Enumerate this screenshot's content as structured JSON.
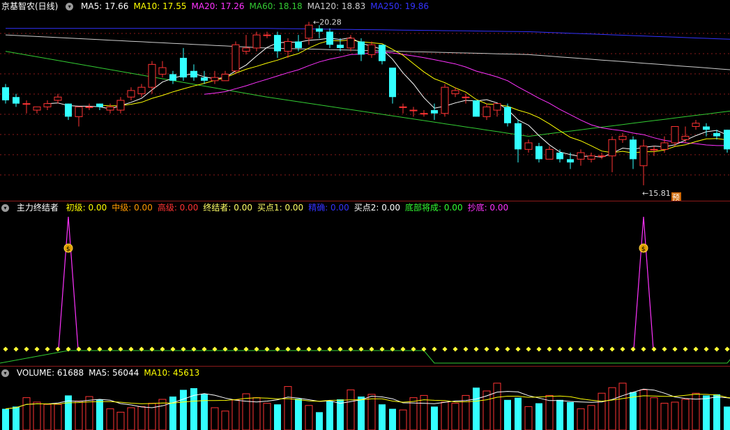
{
  "price_panel": {
    "stock_name": "京基智农(日线)",
    "indicators": [
      {
        "text": "MA5: 17.66",
        "color": "#ffffff"
      },
      {
        "text": "MA10: 17.55",
        "color": "#ffff00"
      },
      {
        "text": "MA20: 17.26",
        "color": "#ff33ff"
      },
      {
        "text": "MA60: 18.18",
        "color": "#33cc33"
      },
      {
        "text": "MA120: 18.83",
        "color": "#cccccc"
      },
      {
        "text": "MA250: 19.86",
        "color": "#3333ff"
      }
    ],
    "high_label": "20.28",
    "low_label": "15.81",
    "pre_badge": "预"
  },
  "signal_panel": {
    "title": "主力终结者",
    "indicators": [
      {
        "text": "初级: 0.00",
        "color": "#ffff00"
      },
      {
        "text": "中级: 0.00",
        "color": "#ff9900"
      },
      {
        "text": "高级: 0.00",
        "color": "#ff3333"
      },
      {
        "text": "终结者: 0.00",
        "color": "#ffff66"
      },
      {
        "text": "买点1: 0.00",
        "color": "#ffff66"
      },
      {
        "text": "精确: 0.00",
        "color": "#3333ff"
      },
      {
        "text": "买点2: 0.00",
        "color": "#ffffff"
      },
      {
        "text": "底部将成: 0.00",
        "color": "#33ff33"
      },
      {
        "text": "抄底: 0.00",
        "color": "#ff33ff"
      }
    ],
    "marker_icon": "money-bag-icon"
  },
  "volume_panel": {
    "indicators": [
      {
        "text": "VOLUME: 61688",
        "color": "#ffffff"
      },
      {
        "text": "MA5: 56044",
        "color": "#ffffff"
      },
      {
        "text": "MA10: 45613",
        "color": "#ffff00"
      }
    ]
  },
  "colors": {
    "up": "#ff3333",
    "down": "#33ffff",
    "grid": "#8b1a1a"
  },
  "chart_data": {
    "type": "candlestick",
    "ylim": [
      15.5,
      21.0
    ],
    "candles": [
      {
        "o": 18.8,
        "c": 18.4,
        "h": 18.9,
        "l": 18.3
      },
      {
        "o": 18.5,
        "c": 18.3,
        "h": 18.6,
        "l": 18.2
      },
      {
        "o": 18.3,
        "c": 18.3,
        "h": 18.4,
        "l": 18.0
      },
      {
        "o": 18.1,
        "c": 18.2,
        "h": 18.2,
        "l": 18.0
      },
      {
        "o": 18.2,
        "c": 18.3,
        "h": 18.4,
        "l": 18.1
      },
      {
        "o": 18.4,
        "c": 18.5,
        "h": 18.6,
        "l": 18.3
      },
      {
        "o": 18.3,
        "c": 17.9,
        "h": 18.3,
        "l": 17.8
      },
      {
        "o": 17.9,
        "c": 18.2,
        "h": 18.2,
        "l": 17.6
      },
      {
        "o": 18.2,
        "c": 18.2,
        "h": 18.3,
        "l": 18.1
      },
      {
        "o": 18.3,
        "c": 18.2,
        "h": 18.3,
        "l": 18.1
      },
      {
        "o": 18.1,
        "c": 18.2,
        "h": 18.3,
        "l": 18.0
      },
      {
        "o": 18.1,
        "c": 18.4,
        "h": 18.5,
        "l": 18.0
      },
      {
        "o": 18.5,
        "c": 18.7,
        "h": 18.8,
        "l": 18.4
      },
      {
        "o": 18.6,
        "c": 18.8,
        "h": 18.9,
        "l": 18.5
      },
      {
        "o": 18.8,
        "c": 19.5,
        "h": 19.6,
        "l": 18.6
      },
      {
        "o": 19.2,
        "c": 19.4,
        "h": 19.6,
        "l": 19.1
      },
      {
        "o": 19.2,
        "c": 19.0,
        "h": 19.3,
        "l": 18.9
      },
      {
        "o": 19.7,
        "c": 19.1,
        "h": 20.0,
        "l": 19.0
      },
      {
        "o": 19.3,
        "c": 19.1,
        "h": 19.5,
        "l": 19.0
      },
      {
        "o": 19.1,
        "c": 19.0,
        "h": 19.3,
        "l": 18.9
      },
      {
        "o": 19.0,
        "c": 19.1,
        "h": 19.3,
        "l": 18.9
      },
      {
        "o": 19.0,
        "c": 19.2,
        "h": 19.3,
        "l": 19.0
      },
      {
        "o": 19.3,
        "c": 20.1,
        "h": 20.2,
        "l": 19.2
      },
      {
        "o": 19.9,
        "c": 20.0,
        "h": 20.4,
        "l": 19.8
      },
      {
        "o": 20.0,
        "c": 20.4,
        "h": 20.5,
        "l": 19.9
      },
      {
        "o": 20.4,
        "c": 20.4,
        "h": 20.5,
        "l": 20.3
      },
      {
        "o": 20.4,
        "c": 19.9,
        "h": 20.5,
        "l": 19.7
      },
      {
        "o": 19.9,
        "c": 20.2,
        "h": 20.3,
        "l": 19.7
      },
      {
        "o": 20.2,
        "c": 20.0,
        "h": 20.4,
        "l": 19.9
      },
      {
        "o": 20.3,
        "c": 20.7,
        "h": 20.8,
        "l": 20.1
      },
      {
        "o": 20.6,
        "c": 20.5,
        "h": 20.7,
        "l": 20.3
      },
      {
        "o": 20.5,
        "c": 20.1,
        "h": 20.6,
        "l": 20.0
      },
      {
        "o": 20.1,
        "c": 20.0,
        "h": 20.3,
        "l": 19.9
      },
      {
        "o": 20.0,
        "c": 20.3,
        "h": 20.4,
        "l": 19.9
      },
      {
        "o": 20.2,
        "c": 19.8,
        "h": 20.3,
        "l": 19.6
      },
      {
        "o": 19.8,
        "c": 20.1,
        "h": 20.2,
        "l": 19.7
      },
      {
        "o": 20.1,
        "c": 19.6,
        "h": 20.1,
        "l": 19.5
      },
      {
        "o": 19.4,
        "c": 18.5,
        "h": 19.4,
        "l": 18.3
      },
      {
        "o": 18.2,
        "c": 18.2,
        "h": 18.3,
        "l": 18.0
      },
      {
        "o": 18.1,
        "c": 18.1,
        "h": 18.2,
        "l": 17.9
      },
      {
        "o": 18.0,
        "c": 18.0,
        "h": 18.1,
        "l": 17.9
      },
      {
        "o": 18.1,
        "c": 18.0,
        "h": 18.3,
        "l": 17.8
      },
      {
        "o": 18.0,
        "c": 18.8,
        "h": 18.9,
        "l": 17.9
      },
      {
        "o": 18.6,
        "c": 18.7,
        "h": 18.8,
        "l": 18.5
      },
      {
        "o": 18.5,
        "c": 18.5,
        "h": 18.6,
        "l": 18.3
      },
      {
        "o": 18.4,
        "c": 17.9,
        "h": 18.4,
        "l": 17.9
      },
      {
        "o": 17.9,
        "c": 18.2,
        "h": 18.3,
        "l": 17.8
      },
      {
        "o": 18.1,
        "c": 18.3,
        "h": 18.3,
        "l": 17.9
      },
      {
        "o": 18.2,
        "c": 17.7,
        "h": 18.3,
        "l": 17.6
      },
      {
        "o": 17.7,
        "c": 16.9,
        "h": 17.8,
        "l": 16.5
      },
      {
        "o": 16.9,
        "c": 17.1,
        "h": 17.2,
        "l": 16.8
      },
      {
        "o": 17.0,
        "c": 16.6,
        "h": 17.1,
        "l": 16.5
      },
      {
        "o": 16.6,
        "c": 16.9,
        "h": 17.0,
        "l": 16.6
      },
      {
        "o": 16.8,
        "c": 16.6,
        "h": 16.9,
        "l": 16.5
      },
      {
        "o": 16.6,
        "c": 16.5,
        "h": 16.8,
        "l": 16.3
      },
      {
        "o": 16.6,
        "c": 16.8,
        "h": 16.9,
        "l": 16.4
      },
      {
        "o": 16.6,
        "c": 16.7,
        "h": 16.8,
        "l": 16.5
      },
      {
        "o": 16.7,
        "c": 16.7,
        "h": 16.8,
        "l": 16.6
      },
      {
        "o": 16.7,
        "c": 17.2,
        "h": 17.3,
        "l": 16.2
      },
      {
        "o": 17.2,
        "c": 17.3,
        "h": 17.4,
        "l": 17.1
      },
      {
        "o": 17.2,
        "c": 16.6,
        "h": 17.3,
        "l": 16.3
      },
      {
        "o": 16.4,
        "c": 17.0,
        "h": 17.2,
        "l": 15.8
      },
      {
        "o": 16.9,
        "c": 16.9,
        "h": 17.0,
        "l": 16.7
      },
      {
        "o": 16.9,
        "c": 17.1,
        "h": 17.3,
        "l": 16.8
      },
      {
        "o": 17.1,
        "c": 17.6,
        "h": 17.6,
        "l": 17.0
      },
      {
        "o": 17.2,
        "c": 17.3,
        "h": 17.6,
        "l": 17.1
      },
      {
        "o": 17.6,
        "c": 17.7,
        "h": 17.8,
        "l": 17.5
      },
      {
        "o": 17.6,
        "c": 17.5,
        "h": 17.7,
        "l": 17.3
      },
      {
        "o": 17.4,
        "c": 17.3,
        "h": 17.5,
        "l": 17.2
      },
      {
        "o": 17.5,
        "c": 16.9,
        "h": 17.5,
        "l": 16.8
      },
      {
        "o": 16.9,
        "c": 17.5,
        "h": 17.6,
        "l": 16.5
      },
      {
        "o": 17.4,
        "c": 17.4,
        "h": 17.6,
        "l": 17.2
      },
      {
        "o": 17.4,
        "c": 17.2,
        "h": 17.5,
        "l": 16.5
      },
      {
        "o": 17.0,
        "c": 17.5,
        "h": 17.6,
        "l": 16.9
      },
      {
        "o": 17.4,
        "c": 17.7,
        "h": 17.8,
        "l": 17.3
      },
      {
        "o": 17.7,
        "c": 18.3,
        "h": 18.5,
        "l": 17.6
      }
    ],
    "ma_flat": {
      "ma60": [
        19.9,
        18.5,
        17.3,
        18.3
      ],
      "ma250": [
        20.6,
        20.6,
        20.5,
        20.2
      ],
      "ma120": [
        20.4,
        20.0,
        19.8,
        19.2
      ]
    },
    "signal_spikes": [
      6,
      61
    ],
    "signal_green_step": [
      [
        0,
        0
      ],
      [
        6,
        1
      ],
      [
        40,
        1
      ],
      [
        41,
        0
      ],
      [
        69,
        0
      ],
      [
        70,
        1
      ],
      [
        75,
        1
      ]
    ],
    "volume": [
      38,
      42,
      58,
      50,
      46,
      46,
      62,
      52,
      60,
      55,
      38,
      32,
      40,
      42,
      48,
      55,
      60,
      72,
      75,
      65,
      40,
      34,
      54,
      65,
      58,
      48,
      46,
      78,
      56,
      44,
      32,
      52,
      55,
      72,
      60,
      64,
      46,
      38,
      36,
      58,
      62,
      42,
      50,
      48,
      62,
      76,
      70,
      84,
      54,
      58,
      42,
      48,
      62,
      54,
      50,
      38,
      44,
      66,
      76,
      84,
      68,
      72,
      58,
      48,
      50,
      55,
      66,
      62,
      64,
      42,
      44,
      56,
      52,
      58,
      70,
      72,
      80
    ]
  }
}
